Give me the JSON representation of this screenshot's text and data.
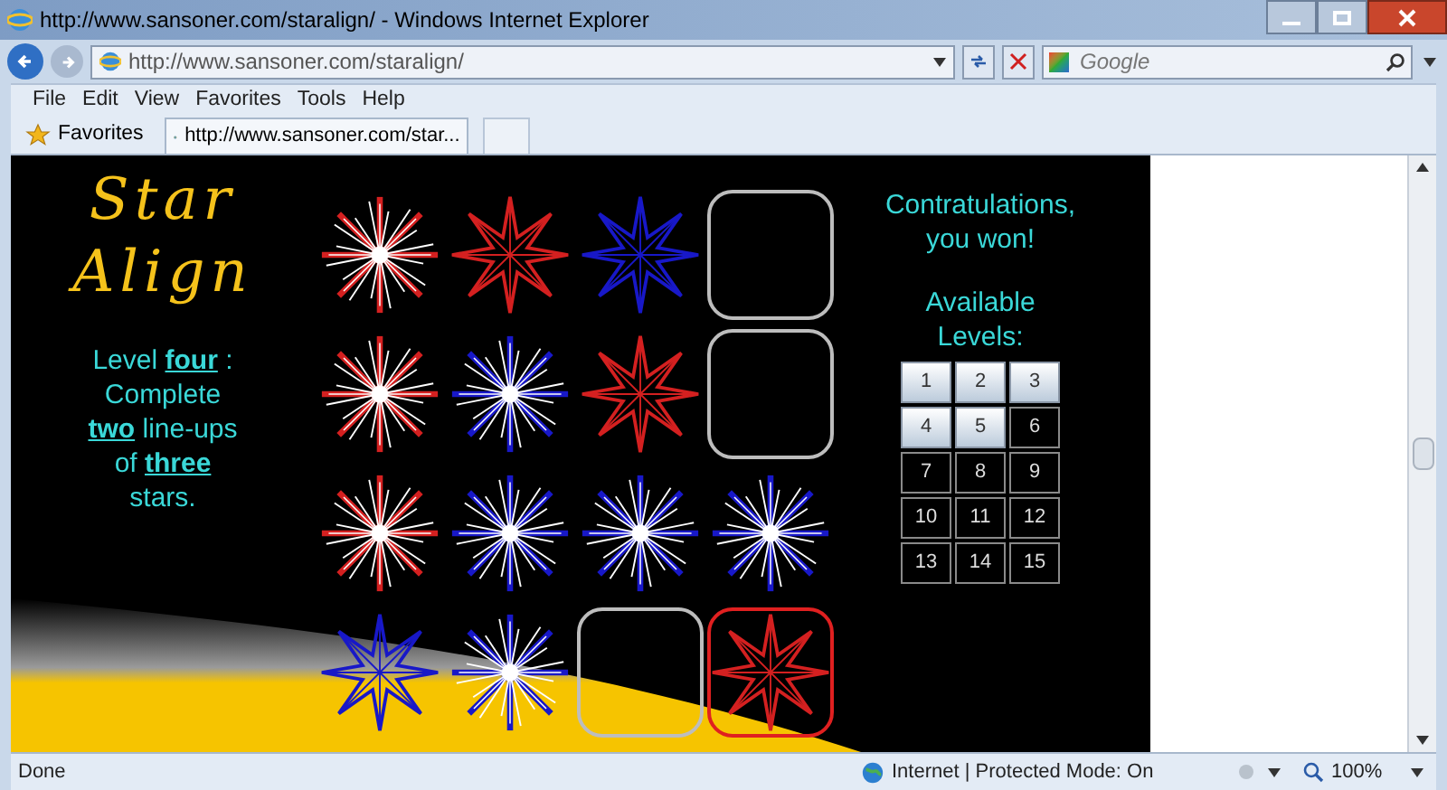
{
  "window": {
    "title": "http://www.sansoner.com/staralign/ - Windows Internet Explorer"
  },
  "address_bar": {
    "value": "http://www.sansoner.com/staralign/"
  },
  "search": {
    "placeholder": "Google"
  },
  "menu": [
    "File",
    "Edit",
    "View",
    "Favorites",
    "Tools",
    "Help"
  ],
  "favorites_bar": {
    "favorites": "Favorites",
    "tab": "http://www.sansoner.com/star..."
  },
  "game": {
    "title_lines": [
      "Star",
      "Align"
    ],
    "instructions": [
      "Level **four** :",
      "Complete",
      "**two** line-ups",
      "of **three**",
      "stars."
    ],
    "message": "Contratulations, you won!",
    "levels_heading": "Available Levels:",
    "grid": [
      [
        {
          "kind": "burst",
          "color": "#d42020",
          "selected": false
        },
        {
          "kind": "star",
          "color": "#d42020",
          "selected": false
        },
        {
          "kind": "star",
          "color": "#1818c8",
          "selected": false
        },
        {
          "kind": "empty",
          "selected": false
        }
      ],
      [
        {
          "kind": "burst",
          "color": "#d42020",
          "selected": false
        },
        {
          "kind": "burst",
          "color": "#1818c8",
          "selected": false
        },
        {
          "kind": "star",
          "color": "#d42020",
          "selected": false
        },
        {
          "kind": "empty",
          "selected": false
        }
      ],
      [
        {
          "kind": "burst",
          "color": "#d42020",
          "selected": false
        },
        {
          "kind": "burst",
          "color": "#1818c8",
          "selected": false
        },
        {
          "kind": "burst",
          "color": "#1818c8",
          "selected": false
        },
        {
          "kind": "burst",
          "color": "#1818c8",
          "selected": false
        }
      ],
      [
        {
          "kind": "star",
          "color": "#1818c8",
          "selected": false
        },
        {
          "kind": "burst",
          "color": "#1818c8",
          "selected": false
        },
        {
          "kind": "empty",
          "selected": false
        },
        {
          "kind": "star",
          "color": "#d42020",
          "selected": true
        }
      ]
    ],
    "levels": [
      {
        "label": "1",
        "available": true
      },
      {
        "label": "2",
        "available": true
      },
      {
        "label": "3",
        "available": true
      },
      {
        "label": "4",
        "available": true
      },
      {
        "label": "5",
        "available": true
      },
      {
        "label": "6",
        "available": false
      },
      {
        "label": "7",
        "available": false
      },
      {
        "label": "8",
        "available": false
      },
      {
        "label": "9",
        "available": false
      },
      {
        "label": "10",
        "available": false
      },
      {
        "label": "11",
        "available": false
      },
      {
        "label": "12",
        "available": false
      },
      {
        "label": "13",
        "available": false
      },
      {
        "label": "14",
        "available": false
      },
      {
        "label": "15",
        "available": false
      }
    ]
  },
  "status_bar": {
    "status": "Done",
    "zone": "Internet | Protected Mode: On",
    "zoom": "100%"
  }
}
